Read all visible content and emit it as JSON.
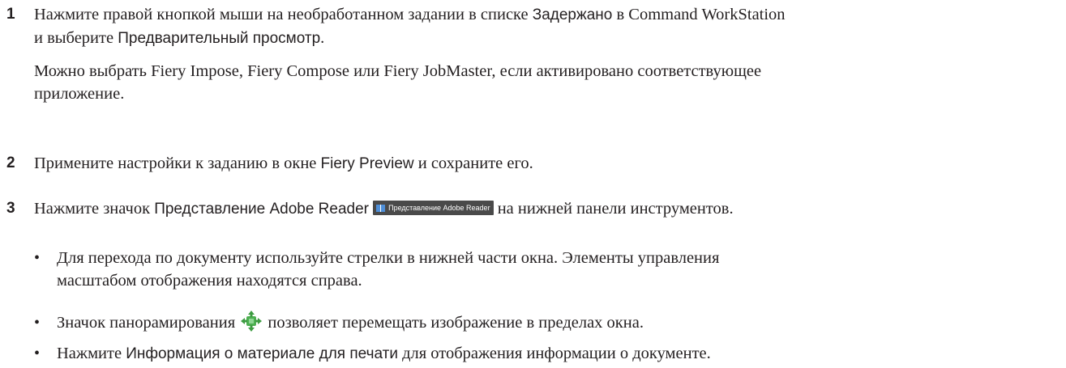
{
  "steps": [
    {
      "number": "1",
      "line1_a": "Нажмите правой кнопкой мыши на необработанном задании в списке ",
      "line1_ui1": "Задержано",
      "line1_b": " в Command WorkStation",
      "line2_a": "и выберите ",
      "line2_ui": "Предварительный просмотр",
      "line2_b": ".",
      "note_line1": "Можно выбрать Fiery Impose, Fiery Compose или Fiery JobMaster, если активировано соответствующее",
      "note_line2": "приложение."
    },
    {
      "number": "2",
      "text_a": "Примените настройки к заданию в окне ",
      "text_ui": "Fiery Preview",
      "text_b": " и сохраните его."
    },
    {
      "number": "3",
      "text_a": "Нажмите значок ",
      "text_ui": "Представление Adobe Reader",
      "button_label": "Представление Adobe Reader",
      "text_b": " на нижней панели инструментов."
    }
  ],
  "bullets": [
    {
      "dot": "•",
      "line1": "Для перехода по документу используйте стрелки в нижней части окна. Элементы управления",
      "line2": "масштабом отображения находятся справа."
    },
    {
      "dot": "•",
      "text_a": "Значок панорамирования ",
      "text_b": " позволяет перемещать изображение в пределах окна."
    },
    {
      "dot": "•",
      "text_a": "Нажмите ",
      "text_ui": "Информация о материале для печати",
      "text_b": " для отображения информации о документе."
    }
  ],
  "icons": {
    "book": "book-icon",
    "pan": "pan-arrows-icon",
    "pan_color": "#4caf50"
  }
}
